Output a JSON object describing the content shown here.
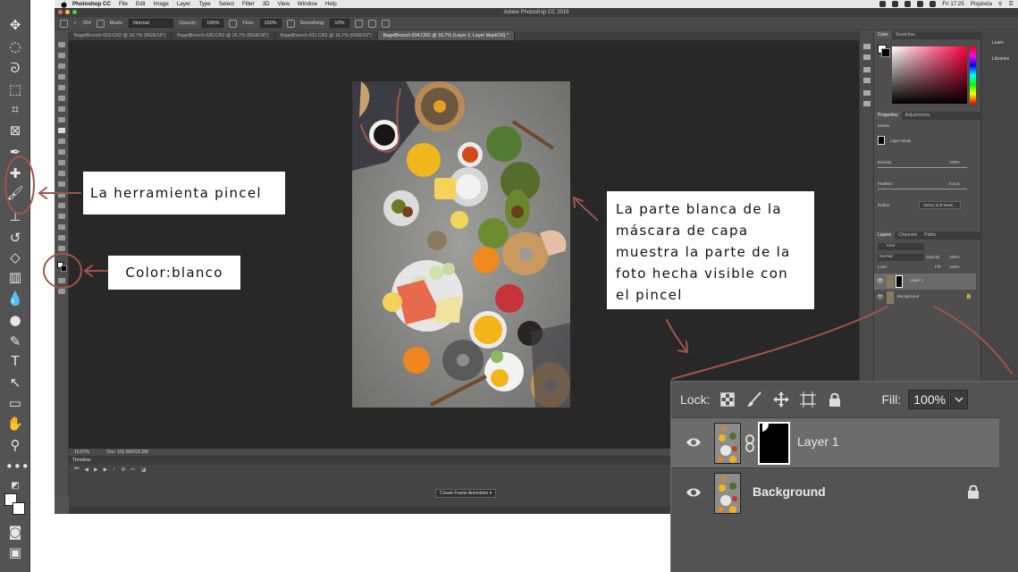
{
  "menubar": {
    "app_name": "Photoshop CC",
    "items": [
      "File",
      "Edit",
      "Image",
      "Layer",
      "Type",
      "Select",
      "Filter",
      "3D",
      "View",
      "Window",
      "Help"
    ],
    "clock": "Fri 17:25",
    "user": "Pispireta"
  },
  "window": {
    "title": "Adobe Photoshop CC 2019"
  },
  "options_bar": {
    "brush_size": "364",
    "mode_label": "Mode:",
    "mode_value": "Normal",
    "opacity_label": "Opacity:",
    "opacity_value": "100%",
    "flow_label": "Flow:",
    "flow_value": "100%",
    "smoothing_label": "Smoothing:",
    "smoothing_value": "10%"
  },
  "tabs": [
    {
      "label": "BagelBrunch-023.CR2 @ 16,7% (RGB/16*)"
    },
    {
      "label": "BagelBrunch-030.CR2 @ 16,7% (RGB/16*)"
    },
    {
      "label": "BagelBrunch-031.CR2 @ 16,7% (RGB/16*)"
    },
    {
      "label": "BagelBrunch-034.CR2 @ 16,7% (Layer 1, Layer Mask/16) *"
    }
  ],
  "status": {
    "zoom": "16,67%",
    "doc": "Doc: 102,5M/222,8M"
  },
  "timeline": {
    "title": "Timeline",
    "create_button": "Create Frame Animation"
  },
  "panels": {
    "color_tabs": [
      "Color",
      "Swatches"
    ],
    "properties_tabs": [
      "Properties",
      "Adjustments"
    ],
    "masks_label": "Masks",
    "layer_mask_label": "Layer Mask",
    "density_label": "Density:",
    "density_value": "100%",
    "feather_label": "Feather:",
    "feather_value": "0,0 px",
    "refine_label": "Refine:",
    "select_mask_button": "Select and Mask...",
    "layers_tabs": [
      "Layers",
      "Channels",
      "Paths"
    ],
    "kind_label": "Kind",
    "blend_mode": "Normal",
    "opacity_label": "Opacity:",
    "opacity_value": "100%",
    "lock_label": "Lock:",
    "fill_label": "Fill:",
    "fill_value": "100%",
    "learn_button": "Learn",
    "libraries_button": "Libraries"
  },
  "layers": [
    {
      "name": "Layer 1",
      "selected": true,
      "has_mask": true
    },
    {
      "name": "Background",
      "selected": false,
      "locked": true
    }
  ],
  "inset": {
    "lock_label": "Lock:",
    "fill_label": "Fill:",
    "fill_value": "100%"
  },
  "annotations": {
    "brush_tool": "La herramienta pincel",
    "color_white": "Color:blanco",
    "mask_note": "La parte blanca de la máscara de capa muestra la parte de la foto hecha visible con el pincel"
  },
  "colors": {
    "annotation_stroke": "#a0544a",
    "ps_bg": "#535353",
    "canvas_bg": "#282828"
  }
}
